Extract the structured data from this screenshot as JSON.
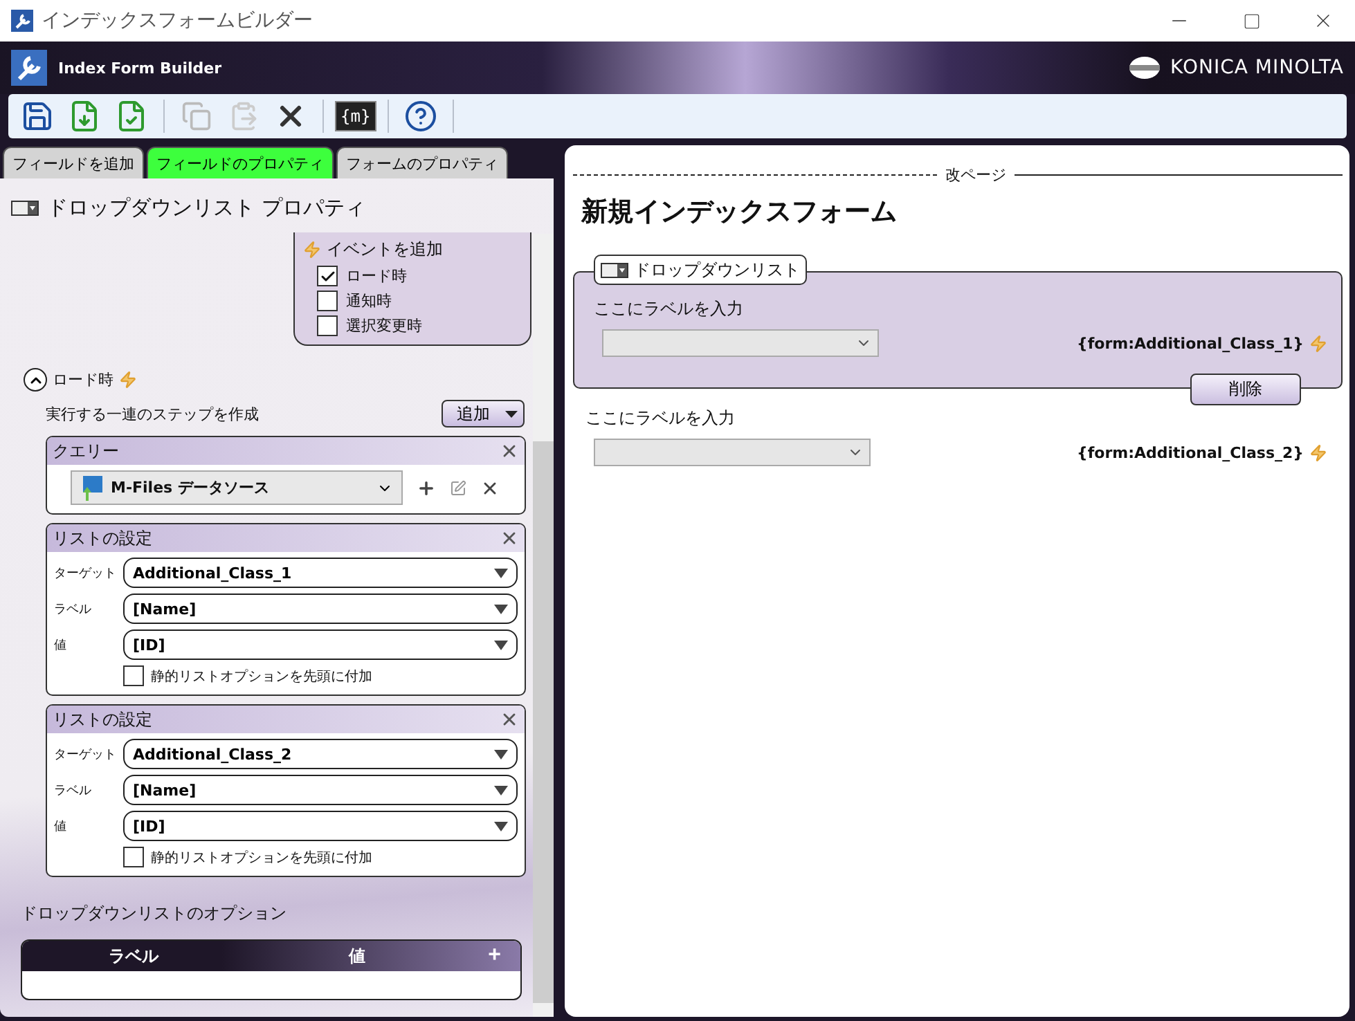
{
  "window": {
    "title": "インデックスフォームビルダー"
  },
  "header": {
    "app_name": "Index Form Builder",
    "brand": "KONICA MINOLTA"
  },
  "toolbar": {
    "variables_label": "{m}"
  },
  "tabs": [
    {
      "label": "フィールドを追加",
      "selected": false
    },
    {
      "label": "フィールドのプロパティ",
      "selected": true
    },
    {
      "label": "フォームのプロパティ",
      "selected": false
    }
  ],
  "properties": {
    "title": "ドロップダウンリスト プロパティ",
    "events": {
      "title": "イベントを追加",
      "items": [
        {
          "label": "ロード時",
          "checked": true
        },
        {
          "label": "通知時",
          "checked": false
        },
        {
          "label": "選択変更時",
          "checked": false
        }
      ]
    },
    "load_section": {
      "title": "ロード時",
      "expanded": true,
      "instruction": "実行する一連のステップを作成",
      "add_button": "追加",
      "steps": [
        {
          "kind": "query",
          "title": "クエリー",
          "datasource": "M-Files データソース"
        },
        {
          "kind": "list",
          "title": "リストの設定",
          "rows": [
            {
              "label": "ターゲット",
              "value": "Additional_Class_1"
            },
            {
              "label": "ラベル",
              "value": "[Name]"
            },
            {
              "label": "値",
              "value": "[ID]"
            }
          ],
          "prepend": {
            "label": "静的リストオプションを先頭に付加",
            "checked": false
          }
        },
        {
          "kind": "list",
          "title": "リストの設定",
          "rows": [
            {
              "label": "ターゲット",
              "value": "Additional_Class_2"
            },
            {
              "label": "ラベル",
              "value": "[Name]"
            },
            {
              "label": "値",
              "value": "[ID]"
            }
          ],
          "prepend": {
            "label": "静的リストオプションを先頭に付加",
            "checked": false
          }
        }
      ]
    },
    "options": {
      "title": "ドロップダウンリストのオプション",
      "columns": [
        "ラベル",
        "値"
      ],
      "add": "+"
    }
  },
  "form": {
    "page_break": "改ページ",
    "title": "新規インデックスフォーム",
    "fields": [
      {
        "selected": true,
        "badge": "ドロップダウンリスト",
        "label": "ここにラベルを入力",
        "binding": "{form:Additional_Class_1}",
        "delete_button": "削除"
      },
      {
        "selected": false,
        "label": "ここにラベルを入力",
        "binding": "{form:Additional_Class_2}"
      }
    ]
  }
}
